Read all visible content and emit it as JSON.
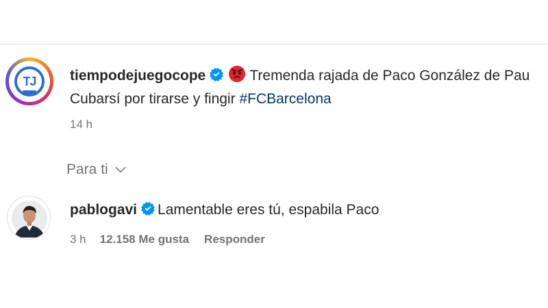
{
  "post": {
    "avatar_logo_text": "TJ",
    "username": "tiempodejuegocope",
    "verified": true,
    "emoji": "angry-face-emoji",
    "caption_text": "Tremenda rajada de Paco González de Pau Cubarsí por tirarse y fingir",
    "hashtag": "#FCBarcelona",
    "time": "14 h"
  },
  "filter": {
    "label": "Para ti",
    "icon": "chevron-down-icon"
  },
  "comment": {
    "username": "pablogavi",
    "verified": true,
    "text": "Lamentable eres tú, espabila Paco",
    "time": "3 h",
    "likes": "12.158 Me gusta",
    "reply_label": "Responder"
  },
  "colors": {
    "verified_blue": "#0095f6",
    "hashtag_blue": "#00376b",
    "secondary_text": "#737373",
    "primary_text": "#262626",
    "divider": "#dbdbdb"
  }
}
